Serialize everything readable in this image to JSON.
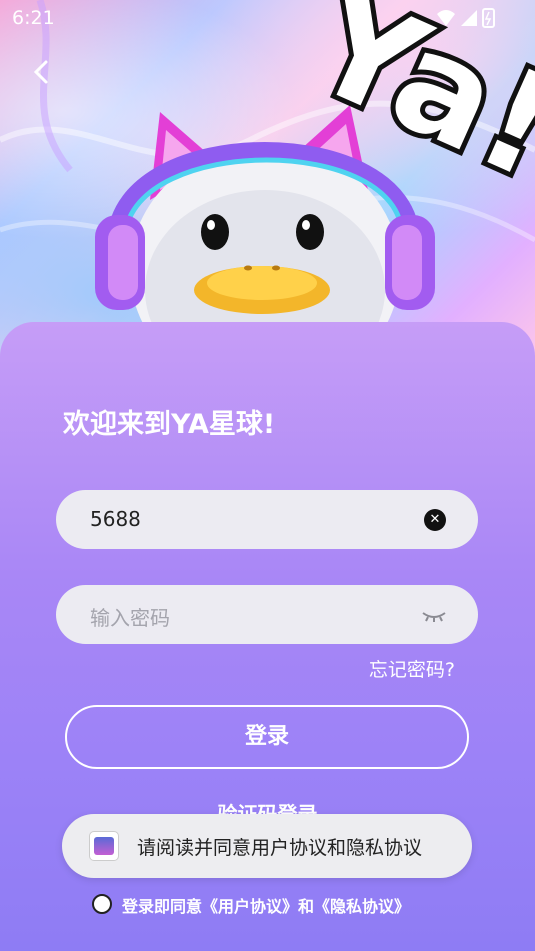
{
  "status_bar": {
    "time": "6:21"
  },
  "hero": {
    "logo_text": "Ya!"
  },
  "welcome": "欢迎来到YA星球!",
  "form": {
    "account_value": "5688",
    "password_placeholder": "输入密码",
    "forgot_password": "忘记密码?",
    "login_button": "登录",
    "code_login": "验证码登录"
  },
  "toast": {
    "message": "请阅读并同意用户协议和隐私协议"
  },
  "agreement": {
    "text": "登录即同意《用户协议》和《隐私协议》",
    "checked": false
  },
  "colors": {
    "card_top": "#c69df7",
    "card_bottom": "#8e7cf4",
    "field_bg": "#ecebf2",
    "beak": "#f3b62a",
    "headphone": "#a25cf0"
  }
}
